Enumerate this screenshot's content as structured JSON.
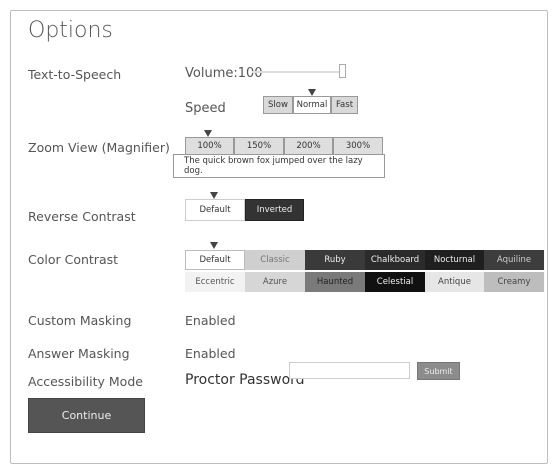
{
  "page": {
    "title": "Options",
    "continue_label": "Continue"
  },
  "tts": {
    "label": "Text-to-Speech",
    "volume_text": "Volume:100",
    "volume_value": 100,
    "speed_label": "Speed",
    "speed_options": [
      "Slow",
      "Normal",
      "Fast"
    ],
    "speed_selected": "Normal"
  },
  "zoom": {
    "label": "Zoom View (Magnifier)",
    "options": [
      "100%",
      "150%",
      "200%",
      "300%"
    ],
    "selected": "100%",
    "sample_text": "The quick brown fox jumped over the lazy dog."
  },
  "reverse_contrast": {
    "label": "Reverse Contrast",
    "options": [
      "Default",
      "Inverted"
    ],
    "selected": "Default"
  },
  "color_contrast": {
    "label": "Color Contrast",
    "selected": "Default",
    "row1": [
      {
        "label": "Default",
        "bg": "#ffffff",
        "fg": "#333333"
      },
      {
        "label": "Classic",
        "bg": "#cfcfcf",
        "fg": "#777777"
      },
      {
        "label": "Ruby",
        "bg": "#3a3a3a",
        "fg": "#eeeeee"
      },
      {
        "label": "Chalkboard",
        "bg": "#2b2b2b",
        "fg": "#eeeeee"
      },
      {
        "label": "Nocturnal",
        "bg": "#1f1f1f",
        "fg": "#eeeeee"
      },
      {
        "label": "Aquiline",
        "bg": "#3d3d3d",
        "fg": "#cccccc"
      }
    ],
    "row2": [
      {
        "label": "Eccentric",
        "bg": "#f2f2f2",
        "fg": "#555555"
      },
      {
        "label": "Azure",
        "bg": "#d6d6d6",
        "fg": "#555555"
      },
      {
        "label": "Haunted",
        "bg": "#7a7a7a",
        "fg": "#222222"
      },
      {
        "label": "Celestial",
        "bg": "#111111",
        "fg": "#eeeeee"
      },
      {
        "label": "Antique",
        "bg": "#e6e6e6",
        "fg": "#444444"
      },
      {
        "label": "Creamy",
        "bg": "#bdbdbd",
        "fg": "#444444"
      }
    ]
  },
  "custom_masking": {
    "label": "Custom Masking",
    "value": "Enabled"
  },
  "answer_masking": {
    "label": "Answer Masking",
    "value": "Enabled"
  },
  "accessibility": {
    "label": "Accessibility Mode",
    "proctor_label": "Proctor Password",
    "password_value": "",
    "submit_label": "Submit"
  }
}
